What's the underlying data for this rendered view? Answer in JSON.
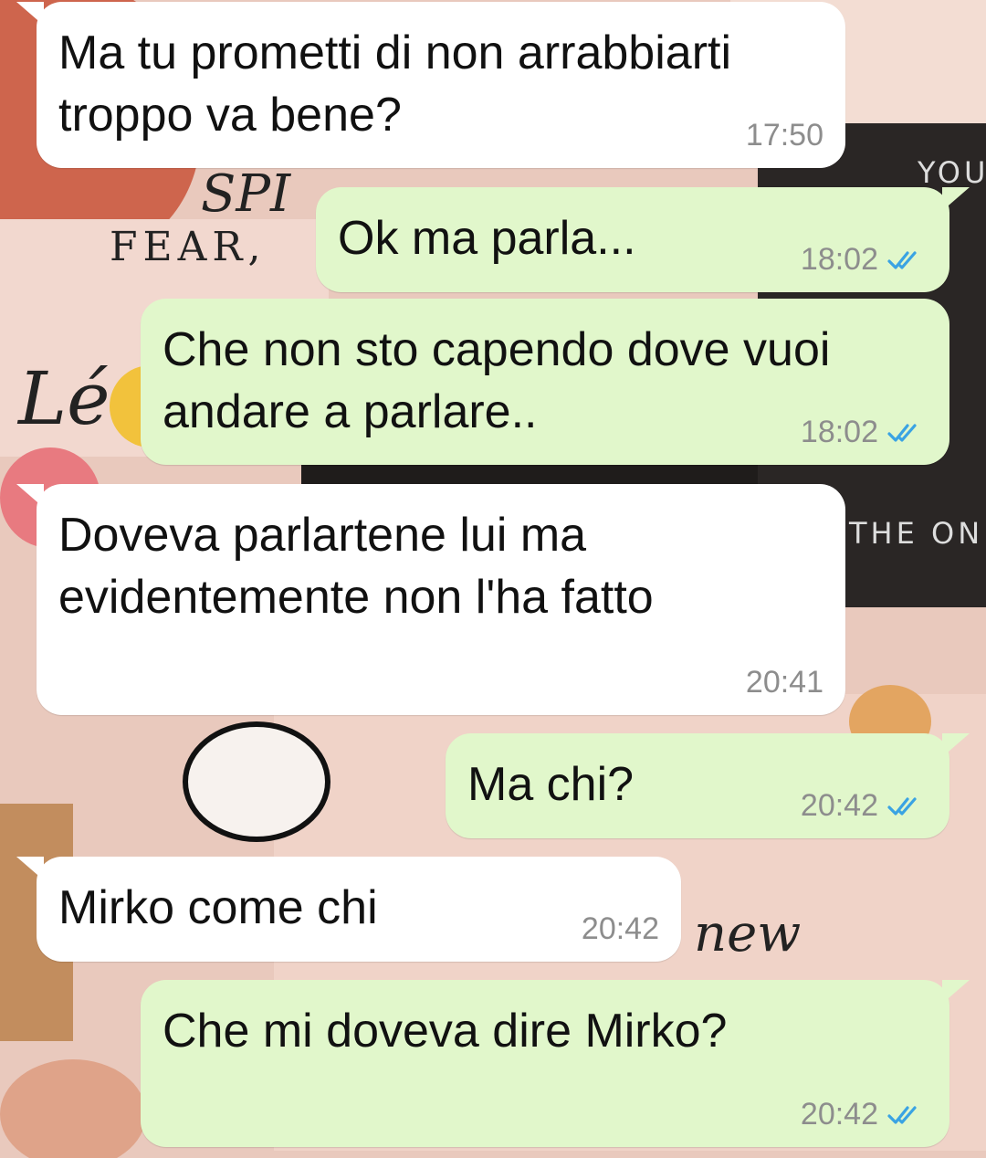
{
  "colors": {
    "incoming_bubble": "#ffffff",
    "outgoing_bubble": "#e1f7cb",
    "read_ticks": "#3aa3e3",
    "timestamp": "#8d8d8d"
  },
  "wallpaper": {
    "words": [
      "SPI",
      "FEAR,",
      "YOU",
      "THE ON",
      "new",
      "Lé"
    ]
  },
  "messages": [
    {
      "direction": "in",
      "text": "Ma tu prometti di non arrabbiarti\ntroppo va bene?",
      "time": "17:50",
      "status": ""
    },
    {
      "direction": "out",
      "text": "Ok ma parla...",
      "time": "18:02",
      "status": "read-ticks-icon"
    },
    {
      "direction": "out",
      "text": "Che non sto capendo dove vuoi\nandare a parlare..",
      "time": "18:02",
      "status": "read-ticks-icon"
    },
    {
      "direction": "in",
      "text": "Doveva parlartene lui ma\nevidentemente non l'ha fatto",
      "time": "20:41",
      "status": ""
    },
    {
      "direction": "out",
      "text": "Ma chi?",
      "time": "20:42",
      "status": "read-ticks-icon"
    },
    {
      "direction": "in",
      "text": "Mirko come chi",
      "time": "20:42",
      "status": ""
    },
    {
      "direction": "out",
      "text": "Che mi doveva dire Mirko?",
      "time": "20:42",
      "status": "read-ticks-icon"
    }
  ]
}
